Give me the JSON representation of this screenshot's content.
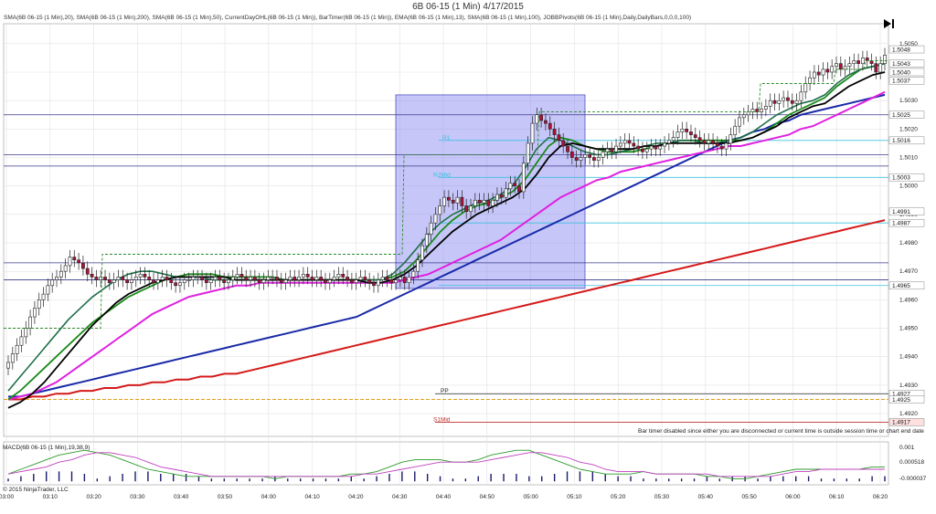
{
  "title": "6B 06-15 (1 Min)  4/17/2015",
  "indicators_line": "SMA(6B 06-15 (1 Min),20), SMA(6B 06-15 (1 Min),200), SMA(6B 06-15 (1 Min),50), CurrentDayOHL(6B 06-15 (1 Min)), BarTimer(6B 06-15 (1 Min)), EMA(6B 06-15 (1 Min),13), SMA(6B 06-15 (1 Min),100), JOBBPivots(6B 06-15 (1 Min),Daily,DailyBars,0,0,0,100)",
  "macd_label": "MACD(6B 06-15 (1 Min),19,38,9)",
  "copyright": "© 2015 NinjaTrader, LLC",
  "bartimer_note": "Bar timer disabled since either you are disconnected or current time is outside session time or chart end date",
  "colors": {
    "sma20": "#1a8a1a",
    "ema13": "#1f6f4a",
    "sma50": "#e020e0",
    "sma100": "#1a2aa8",
    "sma200": "#d41a1a",
    "black_ma": "#000000",
    "up_candle": "#ffffff",
    "down_candle": "#b0103a",
    "pivot": "#40c0e0",
    "shade": "#8080f0",
    "hline": "#3a3a8a"
  },
  "chart_data": {
    "type": "candlestick",
    "x_labels": [
      "03:00",
      "03:10",
      "03:20",
      "03:30",
      "03:40",
      "03:50",
      "04:00",
      "04:10",
      "04:20",
      "04:30",
      "04:40",
      "04:50",
      "05:00",
      "05:10",
      "05:20",
      "05:30",
      "05:40",
      "05:50",
      "06:00",
      "06:10",
      "06:20"
    ],
    "y_ticks": [
      1.492,
      1.493,
      1.494,
      1.495,
      1.496,
      1.497,
      1.498,
      1.499,
      1.5,
      1.501,
      1.502,
      1.503,
      1.504,
      1.505
    ],
    "ylim": [
      1.4912,
      1.5057
    ],
    "price_badges": [
      1.5048,
      1.5043,
      1.504,
      1.5037,
      1.5025,
      1.5016,
      1.5003,
      1.4991,
      1.4987,
      1.4965,
      1.4927,
      1.4925,
      1.4917
    ],
    "pivot_levels": [
      {
        "label": "R1",
        "value": 1.5016,
        "color": "#40c0e0"
      },
      {
        "label": "R2Mid",
        "value": 1.5003,
        "color": "#40c0e0"
      },
      {
        "label": "",
        "value": 1.4987,
        "color": "#40c0e0"
      },
      {
        "label": "",
        "value": 1.4965,
        "color": "#40c0e0"
      },
      {
        "label": "PP",
        "value": 1.4927,
        "color": "#222222"
      },
      {
        "label": "S1Mid",
        "value": 1.4917,
        "color": "#c03030"
      }
    ],
    "horizontal_lines": [
      1.5025,
      1.5011,
      1.5007,
      1.4973,
      1.4967
    ],
    "orange_level": 1.4925,
    "close_series": [
      1.4938,
      1.4941,
      1.4944,
      1.4947,
      1.495,
      1.4954,
      1.4957,
      1.496,
      1.4962,
      1.4965,
      1.4967,
      1.4968,
      1.497,
      1.4972,
      1.4975,
      1.4974,
      1.4973,
      1.4971,
      1.4969,
      1.4968,
      1.4967,
      1.4968,
      1.4967,
      1.4966,
      1.4967,
      1.4968,
      1.4967,
      1.4966,
      1.4967,
      1.4968,
      1.4969,
      1.4968,
      1.4967,
      1.4966,
      1.4967,
      1.4968,
      1.4967,
      1.4966,
      1.4965,
      1.4966,
      1.4967,
      1.4967,
      1.4968,
      1.4968,
      1.4967,
      1.4966,
      1.4967,
      1.4968,
      1.4967,
      1.4966,
      1.4967,
      1.4968,
      1.4969,
      1.4968,
      1.4967,
      1.4968,
      1.4967,
      1.4966,
      1.4967,
      1.4968,
      1.4968,
      1.4967,
      1.4966,
      1.4967,
      1.4968,
      1.4967,
      1.4968,
      1.4969,
      1.4968,
      1.4967,
      1.4968,
      1.4967,
      1.4966,
      1.4967,
      1.4968,
      1.4969,
      1.4968,
      1.4967,
      1.4966,
      1.4967,
      1.4968,
      1.4967,
      1.4966,
      1.4965,
      1.4967,
      1.4968,
      1.4967,
      1.4966,
      1.4967,
      1.4968,
      1.4966,
      1.4968,
      1.497,
      1.4974,
      1.4979,
      1.4983,
      1.4987,
      1.499,
      1.4993,
      1.4996,
      1.4995,
      1.4994,
      1.4996,
      1.4993,
      1.4991,
      1.4993,
      1.4995,
      1.4994,
      1.4995,
      1.4993,
      1.4995,
      1.4997,
      1.4996,
      1.4999,
      1.5001,
      1.5,
      1.4998,
      1.5008,
      1.5015,
      1.5022,
      1.5025,
      1.5023,
      1.5022,
      1.502,
      1.5018,
      1.5016,
      1.5014,
      1.5012,
      1.501,
      1.5009,
      1.501,
      1.5011,
      1.501,
      1.5009,
      1.501,
      1.5012,
      1.5013,
      1.5012,
      1.5014,
      1.5015,
      1.5016,
      1.5015,
      1.5014,
      1.5013,
      1.5012,
      1.5013,
      1.5014,
      1.5013,
      1.5014,
      1.5015,
      1.5016,
      1.5017,
      1.5019,
      1.502,
      1.5019,
      1.5018,
      1.5017,
      1.5016,
      1.5015,
      1.5016,
      1.5015,
      1.5014,
      1.5013,
      1.5015,
      1.5018,
      1.5021,
      1.5024,
      1.5025,
      1.5026,
      1.5027,
      1.5026,
      1.5027,
      1.5028,
      1.503,
      1.5029,
      1.503,
      1.5031,
      1.503,
      1.5029,
      1.503,
      1.5033,
      1.5036,
      1.5038,
      1.504,
      1.5039,
      1.5041,
      1.504,
      1.5042,
      1.5043,
      1.5041,
      1.5042,
      1.5043,
      1.5044,
      1.5043,
      1.5045,
      1.5044,
      1.5043,
      1.504,
      1.5043,
      1.5046
    ],
    "sma20": [
      1.4925,
      1.4928,
      1.4932,
      1.4936,
      1.494,
      1.4944,
      1.4948,
      1.4952,
      1.4955,
      1.4958,
      1.4961,
      1.4963,
      1.4965,
      1.4967,
      1.4968,
      1.4969,
      1.4969,
      1.4969,
      1.4968,
      1.4968,
      1.4968,
      1.4968,
      1.4968,
      1.4967,
      1.4967,
      1.4967,
      1.4967,
      1.4967,
      1.4967,
      1.4967,
      1.4967,
      1.4967,
      1.4968,
      1.497,
      1.4974,
      1.4979,
      1.4984,
      1.4988,
      1.4991,
      1.4993,
      1.4994,
      1.4996,
      1.4998,
      1.5002,
      1.5008,
      1.5014,
      1.5017,
      1.5016,
      1.5014,
      1.5013,
      1.5012,
      1.5012,
      1.5012,
      1.5013,
      1.5014,
      1.5015,
      1.5016,
      1.5016,
      1.5016,
      1.5016,
      1.5016,
      1.5016,
      1.5017,
      1.5019,
      1.5022,
      1.5025,
      1.5027,
      1.5029,
      1.5031,
      1.5035,
      1.5038,
      1.5041,
      1.5042,
      1.5043
    ],
    "ema13": [
      1.4928,
      1.4933,
      1.4938,
      1.4943,
      1.4948,
      1.4953,
      1.4957,
      1.4961,
      1.4964,
      1.4967,
      1.4969,
      1.497,
      1.497,
      1.4969,
      1.4968,
      1.4968,
      1.4968,
      1.4967,
      1.4967,
      1.4967,
      1.4967,
      1.4967,
      1.4967,
      1.4967,
      1.4967,
      1.4967,
      1.4967,
      1.4967,
      1.4967,
      1.4967,
      1.4967,
      1.4967,
      1.4969,
      1.4973,
      1.4978,
      1.4983,
      1.4987,
      1.499,
      1.4992,
      1.4994,
      1.4995,
      1.4997,
      1.5,
      1.5006,
      1.5013,
      1.5017,
      1.5016,
      1.5014,
      1.5012,
      1.5011,
      1.5011,
      1.5012,
      1.5013,
      1.5014,
      1.5015,
      1.5015,
      1.5016,
      1.5016,
      1.5015,
      1.5015,
      1.5016,
      1.5017,
      1.5019,
      1.5022,
      1.5025,
      1.5027,
      1.5029,
      1.503,
      1.5032,
      1.5036,
      1.5039,
      1.5041,
      1.5042,
      1.5043
    ],
    "sma50": [
      1.4925,
      1.4926,
      1.4927,
      1.4929,
      1.4931,
      1.4934,
      1.4937,
      1.494,
      1.4943,
      1.4946,
      1.4949,
      1.4952,
      1.4955,
      1.4957,
      1.4959,
      1.4961,
      1.4962,
      1.4963,
      1.4964,
      1.4965,
      1.4965,
      1.4966,
      1.4966,
      1.4966,
      1.4966,
      1.4966,
      1.4966,
      1.4966,
      1.4966,
      1.4966,
      1.4966,
      1.4966,
      1.4966,
      1.4967,
      1.4968,
      1.4969,
      1.4971,
      1.4973,
      1.4975,
      1.4977,
      1.4979,
      1.4981,
      1.4984,
      1.4987,
      1.499,
      1.4993,
      1.4996,
      1.4998,
      1.5,
      1.5002,
      1.5003,
      1.5005,
      1.5006,
      1.5007,
      1.5008,
      1.5009,
      1.501,
      1.5011,
      1.5012,
      1.5013,
      1.5014,
      1.5014,
      1.5015,
      1.5016,
      1.5017,
      1.5018,
      1.502,
      1.5021,
      1.5023,
      1.5025,
      1.5027,
      1.5029,
      1.5031,
      1.5033
    ],
    "black_ma": [
      1.4922,
      1.4924,
      1.4927,
      1.4931,
      1.4936,
      1.4941,
      1.4946,
      1.4951,
      1.4955,
      1.4959,
      1.4962,
      1.4964,
      1.4966,
      1.4967,
      1.4968,
      1.4968,
      1.4968,
      1.4968,
      1.4968,
      1.4967,
      1.4967,
      1.4967,
      1.4967,
      1.4967,
      1.4967,
      1.4967,
      1.4967,
      1.4967,
      1.4967,
      1.4967,
      1.4966,
      1.4966,
      1.4967,
      1.4969,
      1.4972,
      1.4976,
      1.498,
      1.4984,
      1.4987,
      1.499,
      1.4992,
      1.4994,
      1.4996,
      1.4999,
      1.5004,
      1.501,
      1.5014,
      1.5015,
      1.5014,
      1.5013,
      1.5013,
      1.5013,
      1.5013,
      1.5014,
      1.5014,
      1.5015,
      1.5015,
      1.5015,
      1.5015,
      1.5015,
      1.5015,
      1.5016,
      1.5017,
      1.5019,
      1.5021,
      1.5024,
      1.5026,
      1.5028,
      1.5029,
      1.5032,
      1.5035,
      1.5037,
      1.5039,
      1.504
    ],
    "sma100": [
      1.4926,
      1.4926,
      1.4927,
      1.4928,
      1.4929,
      1.493,
      1.4931,
      1.4932,
      1.4933,
      1.4934,
      1.4935,
      1.4936,
      1.4937,
      1.4938,
      1.4939,
      1.494,
      1.4941,
      1.4942,
      1.4943,
      1.4944,
      1.4945,
      1.4946,
      1.4947,
      1.4948,
      1.4949,
      1.495,
      1.4951,
      1.4952,
      1.4953,
      1.4954,
      1.4956,
      1.4958,
      1.496,
      1.4962,
      1.4964,
      1.4966,
      1.4968,
      1.497,
      1.4972,
      1.4974,
      1.4976,
      1.4978,
      1.498,
      1.4982,
      1.4984,
      1.4986,
      1.4988,
      1.499,
      1.4992,
      1.4994,
      1.4996,
      1.4998,
      1.5,
      1.5002,
      1.5004,
      1.5006,
      1.5008,
      1.501,
      1.5012,
      1.5014,
      1.5016,
      1.5017,
      1.5019,
      1.502,
      1.5022,
      1.5023,
      1.5025,
      1.5026,
      1.5027,
      1.5028,
      1.5029,
      1.503,
      1.5031,
      1.5032
    ],
    "sma200": [
      1.4925,
      1.4925,
      1.4926,
      1.4926,
      1.4927,
      1.4927,
      1.4928,
      1.4928,
      1.4929,
      1.4929,
      1.493,
      1.493,
      1.4931,
      1.4931,
      1.4932,
      1.4932,
      1.4933,
      1.4933,
      1.4934,
      1.4934,
      1.4935,
      1.4936,
      1.4937,
      1.4938,
      1.4939,
      1.494,
      1.4941,
      1.4942,
      1.4943,
      1.4944,
      1.4945,
      1.4946,
      1.4947,
      1.4948,
      1.4949,
      1.495,
      1.4951,
      1.4952,
      1.4953,
      1.4954,
      1.4955,
      1.4956,
      1.4957,
      1.4958,
      1.4959,
      1.496,
      1.4961,
      1.4962,
      1.4963,
      1.4964,
      1.4965,
      1.4966,
      1.4967,
      1.4968,
      1.4969,
      1.497,
      1.4971,
      1.4972,
      1.4973,
      1.4974,
      1.4975,
      1.4976,
      1.4977,
      1.4978,
      1.4979,
      1.498,
      1.4981,
      1.4982,
      1.4983,
      1.4984,
      1.4985,
      1.4986,
      1.4987,
      1.4988
    ],
    "macd": {
      "y_ticks": [
        "0.001",
        "0.000518",
        "-0.000037"
      ],
      "macd_line": [
        0.0,
        0.0002,
        0.0004,
        0.0006,
        0.0008,
        0.0009,
        0.001,
        0.0009,
        0.0008,
        0.0006,
        0.0004,
        0.0002,
        0.0001,
        0.0,
        -0.0001,
        -0.0001,
        -0.0001,
        -0.0001,
        -0.0001,
        -0.0001,
        -0.0001,
        -0.0002,
        -0.0001,
        -0.0001,
        -0.0001,
        -0.0001,
        -0.0001,
        0.0,
        0.0,
        0.0001,
        0.0003,
        0.0005,
        0.0006,
        0.0006,
        0.0006,
        0.0005,
        0.0005,
        0.0006,
        0.0008,
        0.0009,
        0.001,
        0.001,
        0.0008,
        0.0006,
        0.0004,
        0.0002,
        0.0001,
        0.0,
        0.0,
        0.0,
        0.0001,
        0.0,
        0.0,
        0.0,
        0.0,
        -0.0001,
        -0.0001,
        -0.0002,
        -0.0002,
        -0.0001,
        0.0,
        0.0001,
        0.0002,
        0.0002,
        0.0002,
        0.0002,
        0.0002,
        0.0002,
        0.0003,
        0.0003
      ],
      "signal_line": [
        0.0,
        0.0001,
        0.0002,
        0.0003,
        0.0005,
        0.0006,
        0.0008,
        0.0009,
        0.0009,
        0.0008,
        0.0007,
        0.0005,
        0.0003,
        0.0002,
        0.0001,
        0.0,
        -0.0001,
        -0.0001,
        -0.0001,
        -0.0001,
        -0.0001,
        -0.0001,
        -0.0001,
        -0.0001,
        -0.0001,
        -0.0001,
        -0.0001,
        -0.0001,
        0.0,
        0.0,
        0.0001,
        0.0002,
        0.0003,
        0.0004,
        0.0005,
        0.0005,
        0.0005,
        0.0005,
        0.0006,
        0.0007,
        0.0008,
        0.0009,
        0.0009,
        0.0008,
        0.0007,
        0.0005,
        0.0004,
        0.0002,
        0.0001,
        0.0001,
        0.0001,
        0.0,
        0.0,
        0.0,
        0.0,
        0.0,
        -0.0001,
        -0.0001,
        -0.0001,
        -0.0001,
        -0.0001,
        0.0,
        0.0001,
        0.0001,
        0.0002,
        0.0002,
        0.0002,
        0.0002,
        0.0002,
        0.0002
      ]
    }
  }
}
